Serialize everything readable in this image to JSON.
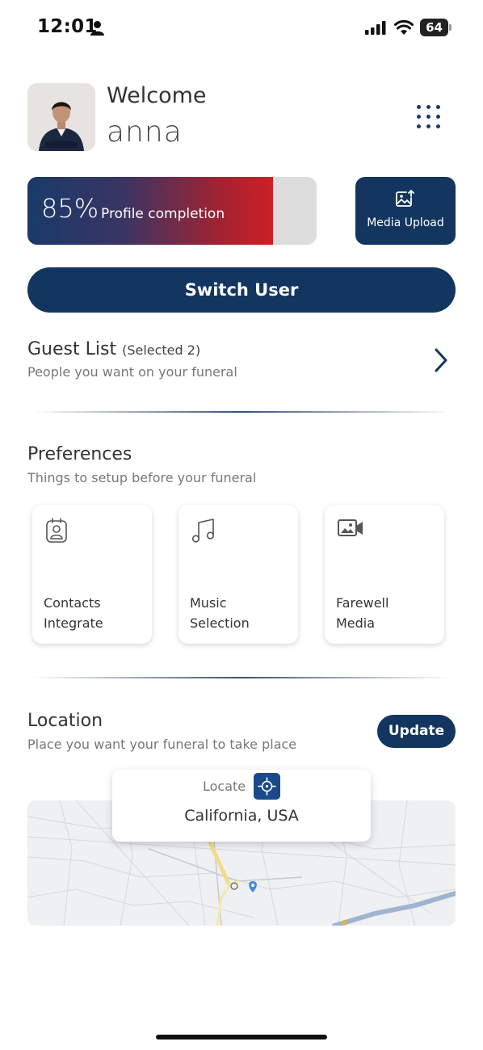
{
  "status_bar": {
    "time": "12:01",
    "battery": "64"
  },
  "header": {
    "welcome": "Welcome",
    "username": "anna"
  },
  "profile": {
    "completion_percent": "85%",
    "completion_value": 0.85,
    "completion_label": "Profile completion"
  },
  "media_upload": {
    "label": "Media Upload"
  },
  "switch_user": {
    "label": "Switch User"
  },
  "guest_list": {
    "title": "Guest List",
    "selected": "(Selected 2)",
    "description": "People you want on your funeral"
  },
  "preferences": {
    "title": "Preferences",
    "description": "Things to setup before your funeral",
    "cards": [
      {
        "line1": "Contacts",
        "line2": "Integrate",
        "icon": "contacts-icon"
      },
      {
        "line1": "Music",
        "line2": "Selection",
        "icon": "music-icon"
      },
      {
        "line1": "Farewell",
        "line2": "Media",
        "icon": "video-icon"
      }
    ]
  },
  "location": {
    "title": "Location",
    "description": "Place you want your funeral to take place",
    "update_label": "Update",
    "locate_label": "Locate",
    "value": "California, USA"
  },
  "colors": {
    "primary": "#123660",
    "accent_red": "#cc2025"
  }
}
